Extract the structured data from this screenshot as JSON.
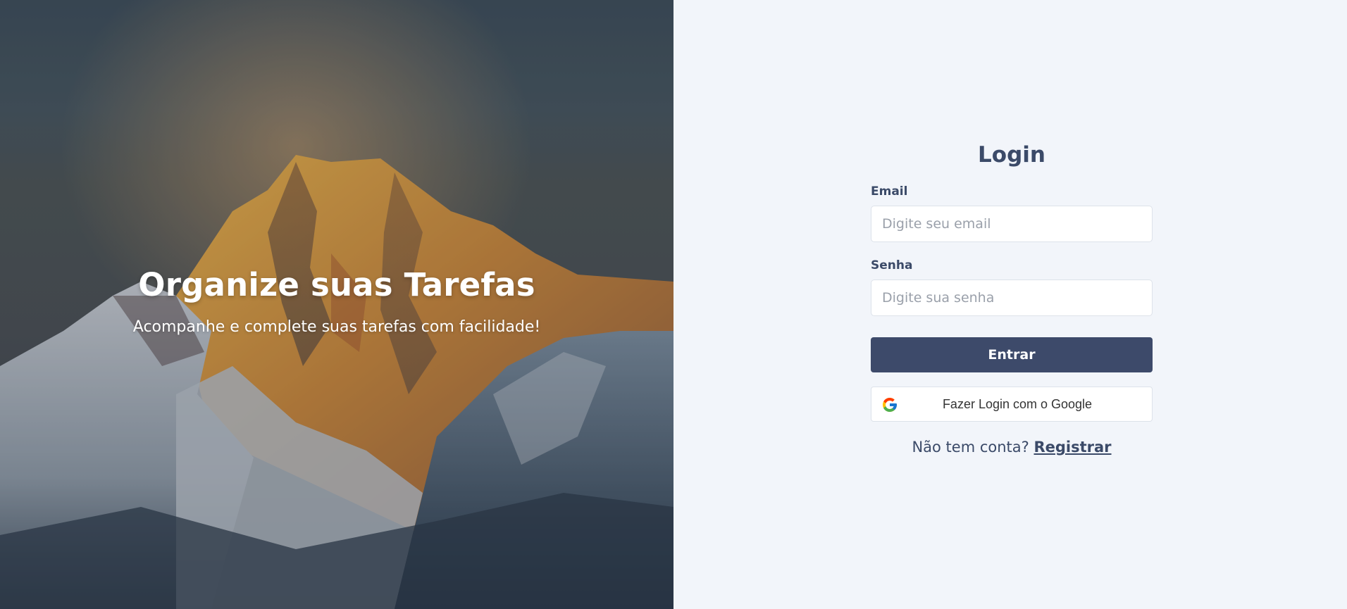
{
  "hero": {
    "title": "Organize suas Tarefas",
    "subtitle": "Acompanhe e complete suas tarefas com facilidade!"
  },
  "login": {
    "title": "Login",
    "email": {
      "label": "Email",
      "placeholder": "Digite seu email",
      "value": ""
    },
    "password": {
      "label": "Senha",
      "placeholder": "Digite sua senha",
      "value": ""
    },
    "submit_label": "Entrar",
    "google_label": "Fazer Login com o Google",
    "google_icon": "google-g-icon",
    "register_prompt": "Não tem conta?",
    "register_link": "Registrar"
  },
  "colors": {
    "primary": "#3d4a6a",
    "text": "#3b4a68",
    "panel_bg": "#f2f5fa",
    "input_border": "#dde2ea"
  }
}
